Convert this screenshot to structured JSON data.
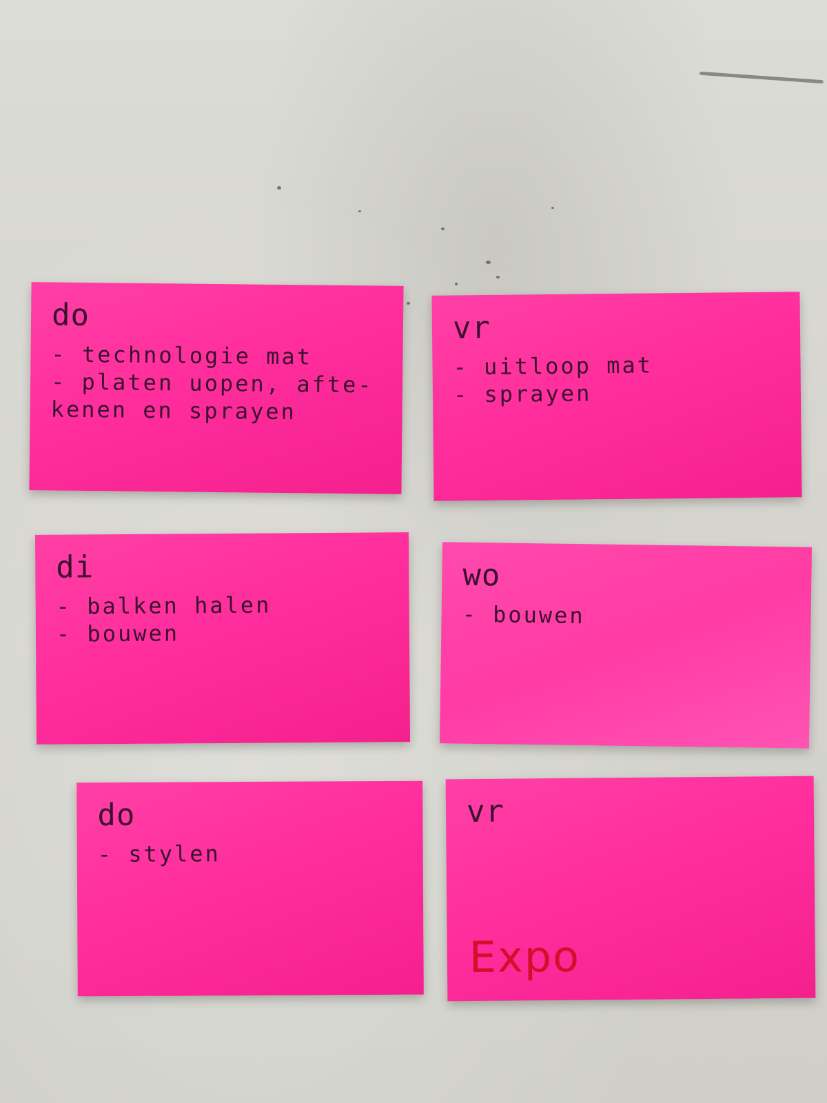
{
  "notes": [
    {
      "day": "do",
      "tasks": [
        "- technologie mat",
        "- platen uopen, afte-",
        "kenen en sprayen"
      ]
    },
    {
      "day": "vr",
      "tasks": [
        "- uitloop mat",
        "- sprayen"
      ]
    },
    {
      "day": "di",
      "tasks": [
        "- balken halen",
        "- bouwen"
      ]
    },
    {
      "day": "wo",
      "tasks": [
        "- bouwen"
      ]
    },
    {
      "day": "do",
      "tasks": [
        "- stylen"
      ]
    },
    {
      "day": "vr",
      "tasks": [],
      "highlight": "Expo"
    }
  ],
  "colors": {
    "note_pink": "#ff2e9c",
    "ink": "#3a1230",
    "highlight_ink": "#d0102a",
    "wall": "#d6d5cf"
  }
}
